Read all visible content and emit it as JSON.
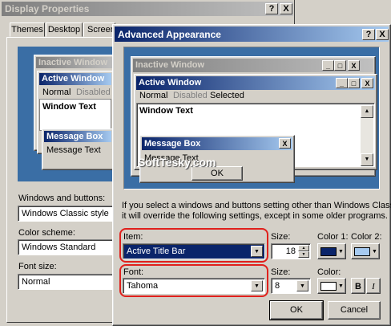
{
  "bg_dialog": {
    "title": "Display Properties",
    "caption_buttons": [
      "?",
      "X"
    ],
    "tabs": [
      "Themes",
      "Desktop",
      "Screen"
    ],
    "preview": {
      "inactive_title": "Inactive Window",
      "active_title": "Active Window",
      "menu": [
        "Normal",
        "Disabled"
      ],
      "window_text": "Window Text",
      "msgbox_title": "Message Box",
      "msgbox_text": "Message Text"
    },
    "windows_buttons_label": "Windows and buttons:",
    "windows_buttons_value": "Windows Classic style",
    "color_scheme_label": "Color scheme:",
    "color_scheme_value": "Windows Standard",
    "font_size_label": "Font size:",
    "font_size_value": "Normal"
  },
  "dialog": {
    "title": "Advanced Appearance",
    "caption_buttons": [
      "?",
      "X"
    ],
    "preview": {
      "inactive_title": "Inactive Window",
      "active_title": "Active Window",
      "menu": [
        "Normal",
        "Disabled",
        "Selected"
      ],
      "window_text": "Window Text",
      "msgbox_title": "Message Box",
      "msgbox_text": "Message Text",
      "ok": "OK",
      "win_buttons": [
        "_",
        "□",
        "X"
      ]
    },
    "watermark": "SoftTesky.com",
    "info_text_1": "If you select a windows and buttons setting other than Windows Classic,",
    "info_text_2": "it will override the following settings, except in some older programs.",
    "item_label": "Item:",
    "item_value": "Active Title Bar",
    "size_label": "Size:",
    "size_value": "18",
    "color1_label": "Color 1:",
    "color2_label": "Color 2:",
    "font_label": "Font:",
    "font_value": "Tahoma",
    "font_size_label": "Size:",
    "font_size_value": "8",
    "font_color_label": "Color:",
    "bold_label": "B",
    "italic_label": "I",
    "ok": "OK",
    "cancel": "Cancel"
  },
  "colors": {
    "color1": "#0a246a",
    "color2": "#a6caf0",
    "font_color": "#ffffff",
    "highlight": "#e0201c"
  }
}
